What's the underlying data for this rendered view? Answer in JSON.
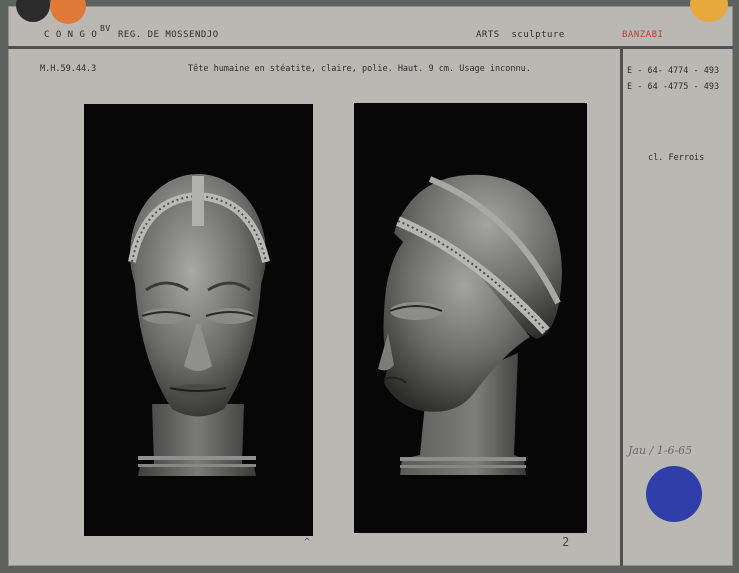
{
  "header": {
    "country": "C O N G O",
    "country_suffix": "BV",
    "region": "REG. DE MOSSENDJO",
    "category": "ARTS  sculpture",
    "group": "BANZABI"
  },
  "inventory_number": "M.H.59.44.3",
  "description": "Tête humaine en stéatite, claire, polie. Haut. 9 cm. Usage inconnu.",
  "references": [
    "E - 64- 4774 - 493",
    "E - 64 -4775 - 493"
  ],
  "photographer": "cl. Ferrois",
  "photo_labels": [
    "^",
    "2"
  ],
  "handwritten_date": "Jau / 1-6-65",
  "colors": {
    "dot_black": "#2b2b2b",
    "dot_orange": "#e07a3a",
    "dot_yellow": "#e8a83c",
    "dot_blue": "#2f3ea8",
    "group_red": "#b8403a"
  },
  "photos": [
    {
      "alt": "Front view of carved soapstone human head with banded headdress"
    },
    {
      "alt": "Profile view of carved soapstone human head with banded headdress"
    }
  ]
}
